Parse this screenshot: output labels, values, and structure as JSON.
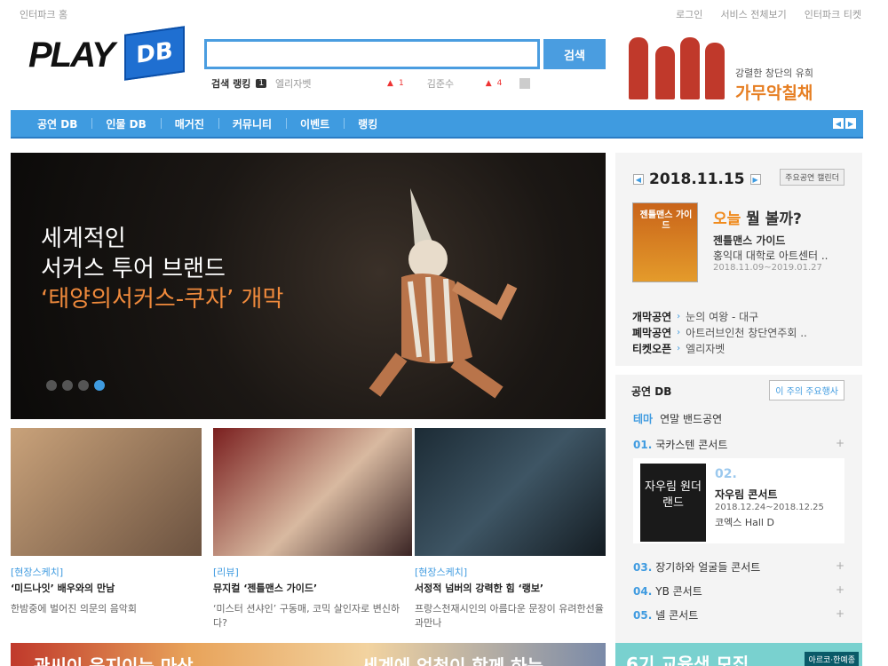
{
  "util": {
    "home": "인터파크 홈",
    "login": "로그인",
    "all_services": "서비스 전체보기",
    "ticket": "인터파크 티켓"
  },
  "header": {
    "logo_play": "PLAY",
    "logo_db": "DB",
    "search_placeholder": "",
    "search_button": "검색",
    "rank_label": "검색 랭킹",
    "rank_num": "1",
    "rank_kw1": "엘리자벳",
    "rank_up1": "1",
    "rank_kw2": "김준수",
    "rank_up2": "4",
    "ad_sub": "강렬한 창단의 유희",
    "ad_title": "가무악칠채"
  },
  "nav": {
    "items": [
      "공연 DB",
      "인물 DB",
      "매거진",
      "커뮤니티",
      "이벤트",
      "랭킹"
    ]
  },
  "hero": {
    "line1": "세계적인",
    "line2": "서커스 투어 브랜드",
    "line3": "‘태양의서커스-쿠자’ 개막"
  },
  "cards": [
    {
      "tag": "[현장스케치]",
      "title": "‘미드나잇’ 배우와의 만남",
      "desc": "한밤중에 벌어진 의문의 음악회"
    },
    {
      "tag": "[리뷰]",
      "title": "뮤지컬 ‘젠틀맨스 가이드’",
      "desc": "‘미스터 션샤인’ 구동매, 코믹 살인자로 변신하다?"
    },
    {
      "tag": "[현장스케치]",
      "title": "서정적 넘버의 강력한 힘 ‘랭보’",
      "desc": "프랑스천재시인의 아름다운 문장이 유려한선율과만나"
    }
  ],
  "today": {
    "date": "2018.11.15",
    "calendar_btn": "주요공연 캘린더",
    "today_word": "오늘",
    "today_rest": " 뭘 볼까?",
    "poster_text": "젠틀맨스 가이드",
    "show_title": "젠틀맨스 가이드",
    "venue": "홍익대 대학로 아트센터 ..",
    "period": "2018.11.09~2019.01.27",
    "list": [
      {
        "k": "개막공연",
        "v": "눈의 여왕 - 대구"
      },
      {
        "k": "폐막공연",
        "v": "아트러브인천 창단연주회 .."
      },
      {
        "k": "티켓오픈",
        "v": "엘리자벳"
      }
    ]
  },
  "db": {
    "title": "공연 DB",
    "weekly_btn": "이 주의 주요행사",
    "theme_k": "테마",
    "theme_v": "연말 밴드공연",
    "items": [
      {
        "n": "01.",
        "t": "국카스텐 콘서트"
      },
      {
        "n": "03.",
        "t": "장기하와 얼굴들 콘서트"
      },
      {
        "n": "04.",
        "t": "YB 콘서트"
      },
      {
        "n": "05.",
        "t": "넬 콘서트"
      }
    ],
    "feat": {
      "n": "02.",
      "poster": "자우림 원더랜드",
      "t": "자우림 콘서트",
      "d": "2018.12.24~2018.12.25",
      "v": "코엑스 Hall D"
    }
  },
  "banners": {
    "b1a": "관씨이 음지이는 마상",
    "b1b": "세계에 엄청이 함께 하는",
    "b2": "6기 교육생 모집",
    "b2tag": "아르코·한예종"
  }
}
